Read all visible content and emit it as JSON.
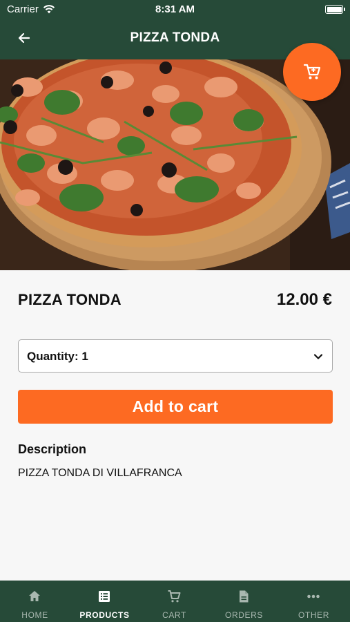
{
  "status": {
    "carrier": "Carrier",
    "time": "8:31 AM"
  },
  "header": {
    "title": "PIZZA TONDA",
    "back_icon": "arrow-left-icon"
  },
  "cart_fab": {
    "icon": "cart-icon"
  },
  "carousel": {
    "page_count": 1,
    "active_page": 1
  },
  "product": {
    "name": "PIZZA TONDA",
    "price": "12.00 €",
    "quantity_label": "Quantity: 1",
    "add_to_cart_label": "Add to cart",
    "description_title": "Description",
    "description": "PIZZA TONDA DI VILLAFRANCA"
  },
  "tabs": [
    {
      "label": "HOME",
      "icon": "home-icon",
      "active": false
    },
    {
      "label": "PRODUCTS",
      "icon": "list-icon",
      "active": true
    },
    {
      "label": "CART",
      "icon": "cart-icon",
      "active": false
    },
    {
      "label": "ORDERS",
      "icon": "document-icon",
      "active": false
    },
    {
      "label": "OTHER",
      "icon": "more-icon",
      "active": false
    }
  ],
  "colors": {
    "header_bg": "#264a38",
    "accent": "#fd6a22",
    "background": "#f7f7f7"
  }
}
